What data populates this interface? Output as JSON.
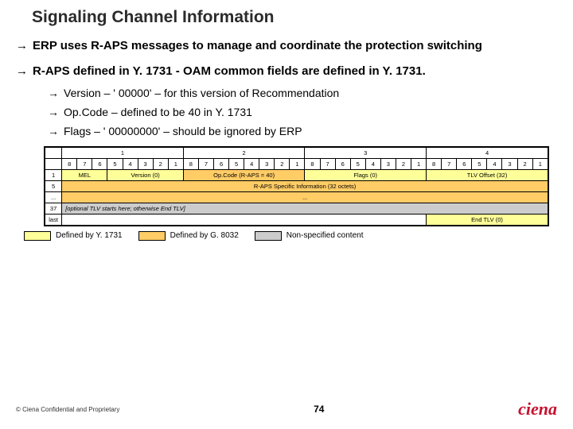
{
  "title": "Signaling Channel Information",
  "bullets": {
    "b1": "ERP uses R-APS messages to manage and coordinate the protection switching",
    "b2": "R-APS defined in Y. 1731 - OAM common fields are defined in Y. 1731.",
    "s1": "Version – ' 00000' – for this version of Recommendation",
    "s2": "Op.Code – defined to be 40 in Y. 1731",
    "s3": "Flags – ' 00000000' – should be ignored by ERP"
  },
  "table": {
    "bytecols": {
      "c1": "1",
      "c2": "2",
      "c3": "3",
      "c4": "4"
    },
    "bits": {
      "b8": "8",
      "b7": "7",
      "b6": "6",
      "b5": "5",
      "b4": "4",
      "b3": "3",
      "b2": "2",
      "b1": "1"
    },
    "rows": {
      "r1": "1",
      "r5": "5",
      "rdots": "...",
      "r37": "37",
      "rlast": "last"
    },
    "mel": "MEL",
    "version": "Version (0)",
    "opcode": "Op.Code (R-APS = 40)",
    "flags": "Flags (0)",
    "tlvoffset": "TLV Offset (32)",
    "rapsinfo": "R-APS Specific Information (32 octets)",
    "ellipsis": "...",
    "opttlv": "[optional TLV starts here; otherwise End TLV]",
    "endtlv": "End TLV (0)"
  },
  "legend": {
    "y1731": "Defined by Y. 1731",
    "g8032": "Defined by G. 8032",
    "nonspec": "Non-specified content"
  },
  "footer": {
    "copy": "© Ciena Confidential and Proprietary",
    "page": "74",
    "logo": "ciena"
  }
}
